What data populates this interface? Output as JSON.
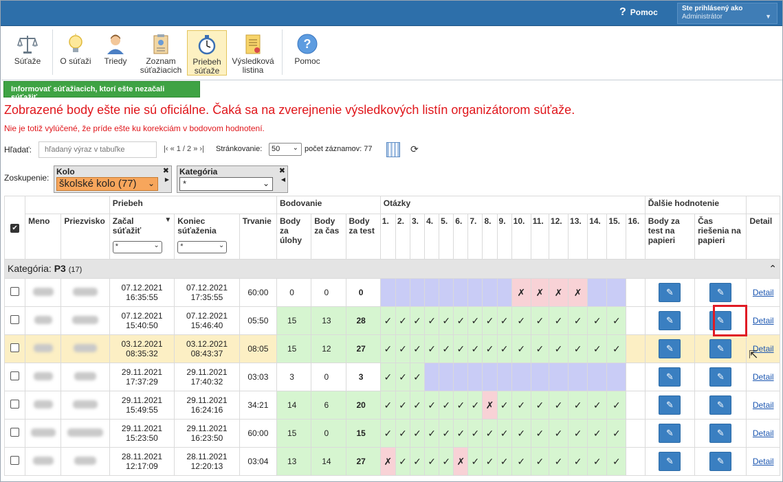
{
  "header": {
    "help_label": "Pomoc",
    "user_line1": "Ste prihlásený ako",
    "user_line2": "Administrátor"
  },
  "toolbar": {
    "items": [
      {
        "label": "Súťaže",
        "icon": "scales-icon"
      },
      {
        "label": "O súťaži",
        "icon": "lightbulb-icon"
      },
      {
        "label": "Triedy",
        "icon": "person-icon"
      },
      {
        "label": "Zoznam súťažiacich",
        "icon": "clipboard-list-icon"
      },
      {
        "label": "Priebeh súťaže",
        "icon": "stopwatch-icon"
      },
      {
        "label": "Výsledková listina",
        "icon": "results-document-icon"
      },
      {
        "label": "Pomoc",
        "icon": "help-circle-icon"
      }
    ]
  },
  "main": {
    "inform_button": "Informovať súťažiacich, ktorí ešte nezačali súťažiť",
    "warning_main": "Zobrazené body ešte nie sú oficiálne. Čaká sa na zverejnenie výsledkových listín organizátorom súťaže.",
    "warning_sub": "Nie je totiž vylúčené, že príde ešte ku korekciám v bodovom hodnotení.",
    "search_label": "Hľadať:",
    "search_placeholder": "hľadaný výraz v tabuľke",
    "pager": "|‹ « 1 / 2 » ›|",
    "per_page_label": "Stránkovanie:",
    "per_page_value": "50",
    "record_count": "počet záznamov: 77",
    "grouping_label": "Zoskupenie:",
    "group_kolo_title": "Kolo",
    "group_kolo_value": "školské kolo (77)",
    "group_kat_title": "Kategória",
    "group_kat_value": "*"
  },
  "table": {
    "group_headers": {
      "priebeh": "Priebeh",
      "bodovanie": "Bodovanie",
      "otazky": "Otázky",
      "dalsie": "Ďalšie hodnotenie"
    },
    "headers": {
      "meno": "Meno",
      "priezvisko": "Priezvisko",
      "zacal": "Začal súťažiť",
      "koniec": "Koniec súťaženia",
      "trvanie": "Trvanie",
      "body_ulohy": "Body za úlohy",
      "body_cas": "Body za čas",
      "body_test": "Body za test",
      "body_papier": "Body za test na papieri",
      "cas_papier": "Čas riešenia na papieri",
      "detail": "Detail",
      "filter_value": "*"
    },
    "questions": [
      "1.",
      "2.",
      "3.",
      "4.",
      "5.",
      "6.",
      "7.",
      "8.",
      "9.",
      "10.",
      "11.",
      "12.",
      "13.",
      "14.",
      "15.",
      "16."
    ],
    "category_label": "Kategória:",
    "category_name": "P3",
    "category_count": "(17)",
    "detail_link": "Detail",
    "rows": [
      {
        "start_date": "07.12.2021",
        "start_time": "16:35:55",
        "end_date": "07.12.2021",
        "end_time": "17:35:55",
        "dur": "60:00",
        "ulohy": "0",
        "cas": "0",
        "test": "0",
        "q": [
          "na",
          "na",
          "na",
          "na",
          "na",
          "na",
          "na",
          "na",
          "na",
          "bad",
          "bad",
          "bad",
          "bad",
          "na",
          "na",
          ""
        ]
      },
      {
        "start_date": "07.12.2021",
        "start_time": "15:40:50",
        "end_date": "07.12.2021",
        "end_time": "15:46:40",
        "dur": "05:50",
        "ulohy": "15",
        "cas": "13",
        "test": "28",
        "q": [
          "ok",
          "ok",
          "ok",
          "ok",
          "ok",
          "ok",
          "ok",
          "ok",
          "ok",
          "ok",
          "ok",
          "ok",
          "ok",
          "ok",
          "ok",
          ""
        ]
      },
      {
        "start_date": "03.12.2021",
        "start_time": "08:35:32",
        "end_date": "03.12.2021",
        "end_time": "08:43:37",
        "dur": "08:05",
        "ulohy": "15",
        "cas": "12",
        "test": "27",
        "q": [
          "ok",
          "ok",
          "ok",
          "ok",
          "ok",
          "ok",
          "ok",
          "ok",
          "ok",
          "ok",
          "ok",
          "ok",
          "ok",
          "ok",
          "ok",
          ""
        ]
      },
      {
        "start_date": "29.11.2021",
        "start_time": "17:37:29",
        "end_date": "29.11.2021",
        "end_time": "17:40:32",
        "dur": "03:03",
        "ulohy": "3",
        "cas": "0",
        "test": "3",
        "q": [
          "ok",
          "ok",
          "ok",
          "na",
          "na",
          "na",
          "na",
          "na",
          "na",
          "na",
          "na",
          "na",
          "na",
          "na",
          "na",
          ""
        ]
      },
      {
        "start_date": "29.11.2021",
        "start_time": "15:49:55",
        "end_date": "29.11.2021",
        "end_time": "16:24:16",
        "dur": "34:21",
        "ulohy": "14",
        "cas": "6",
        "test": "20",
        "q": [
          "ok",
          "ok",
          "ok",
          "ok",
          "ok",
          "ok",
          "ok",
          "bad",
          "ok",
          "ok",
          "ok",
          "ok",
          "ok",
          "ok",
          "ok",
          ""
        ]
      },
      {
        "start_date": "29.11.2021",
        "start_time": "15:23:50",
        "end_date": "29.11.2021",
        "end_time": "16:23:50",
        "dur": "60:00",
        "ulohy": "15",
        "cas": "0",
        "test": "15",
        "q": [
          "ok",
          "ok",
          "ok",
          "ok",
          "ok",
          "ok",
          "ok",
          "ok",
          "ok",
          "ok",
          "ok",
          "ok",
          "ok",
          "ok",
          "ok",
          ""
        ]
      },
      {
        "start_date": "28.11.2021",
        "start_time": "12:17:09",
        "end_date": "28.11.2021",
        "end_time": "12:20:13",
        "dur": "03:04",
        "ulohy": "13",
        "cas": "14",
        "test": "27",
        "q": [
          "bad",
          "ok",
          "ok",
          "ok",
          "ok",
          "bad",
          "ok",
          "ok",
          "ok",
          "ok",
          "ok",
          "ok",
          "ok",
          "ok",
          "ok",
          ""
        ]
      }
    ]
  },
  "colors": {
    "topbar": "#2d6faa",
    "ok": "#d6f5d0",
    "bad": "#f8d2d6",
    "na": "#c9ccf6",
    "highlight_row": "#fcefc4",
    "button_blue": "#3a7fc1",
    "warning_red": "#e0161b"
  }
}
